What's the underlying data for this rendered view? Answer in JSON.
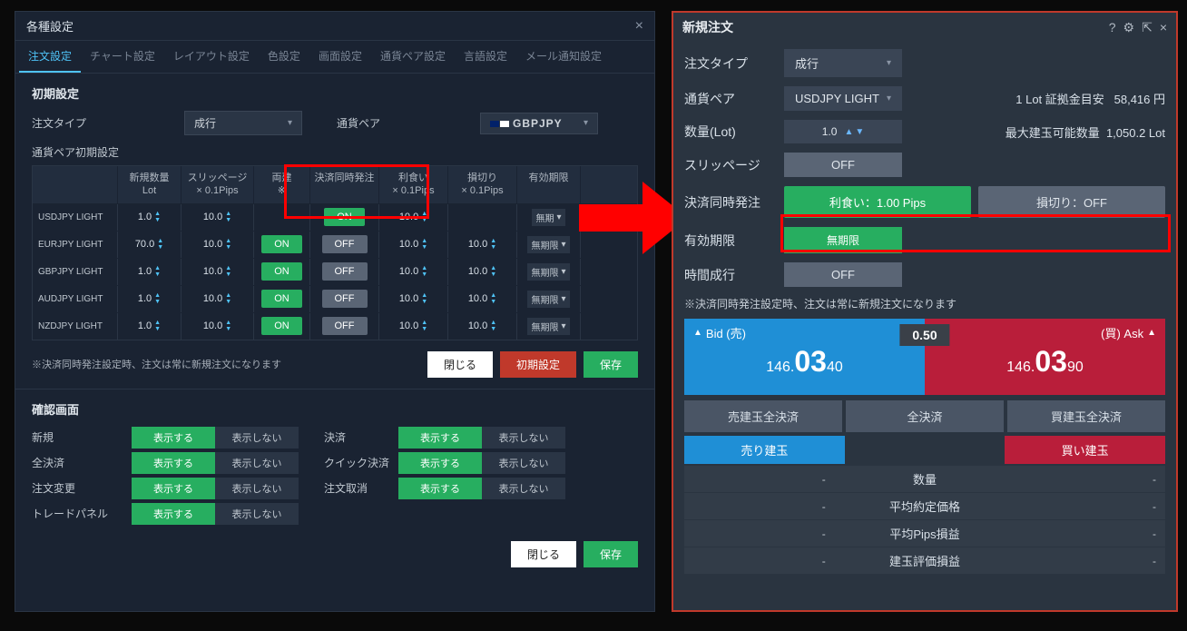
{
  "left": {
    "title": "各種設定",
    "tabs": [
      "注文設定",
      "チャート設定",
      "レイアウト設定",
      "色設定",
      "画面設定",
      "通貨ペア設定",
      "言語設定",
      "メール通知設定"
    ],
    "active_tab": 0,
    "section1_title": "初期設定",
    "order_type_label": "注文タイプ",
    "order_type_value": "成行",
    "pair_label": "通貨ペア",
    "pair_value": "GBPJPY",
    "pair_init_label": "通貨ペア初期設定",
    "headers": [
      "",
      "新規数量\nLot",
      "スリッページ\n× 0.1Pips",
      "両建\n※",
      "決済同時発注",
      "利食い\n× 0.1Pips",
      "損切り\n× 0.1Pips",
      "有効期限"
    ],
    "rows": [
      {
        "pair": "USDJPY LIGHT",
        "lot": "1.0",
        "slip": "10.0",
        "both": "",
        "settle": "ON",
        "tp": "10.0",
        "sl": "",
        "exp": "無期"
      },
      {
        "pair": "EURJPY LIGHT",
        "lot": "70.0",
        "slip": "10.0",
        "both": "ON",
        "settle": "OFF",
        "tp": "10.0",
        "sl": "10.0",
        "exp": "無期限"
      },
      {
        "pair": "GBPJPY LIGHT",
        "lot": "1.0",
        "slip": "10.0",
        "both": "ON",
        "settle": "OFF",
        "tp": "10.0",
        "sl": "10.0",
        "exp": "無期限"
      },
      {
        "pair": "AUDJPY LIGHT",
        "lot": "1.0",
        "slip": "10.0",
        "both": "ON",
        "settle": "OFF",
        "tp": "10.0",
        "sl": "10.0",
        "exp": "無期限"
      },
      {
        "pair": "NZDJPY LIGHT",
        "lot": "1.0",
        "slip": "10.0",
        "both": "ON",
        "settle": "OFF",
        "tp": "10.0",
        "sl": "10.0",
        "exp": "無期限"
      }
    ],
    "note": "※決済同時発注設定時、注文は常に新規注文になります",
    "btn_close": "閉じる",
    "btn_reset": "初期設定",
    "btn_save": "保存",
    "section2_title": "確認画面",
    "confirm": [
      {
        "l": "新規",
        "r": "決済"
      },
      {
        "l": "全決済",
        "r": "クイック決済"
      },
      {
        "l": "注文変更",
        "r": "注文取消"
      },
      {
        "l": "トレードパネル",
        "r": ""
      }
    ],
    "show_label": "表示する",
    "hide_label": "表示しない"
  },
  "right": {
    "title": "新規注文",
    "order_type_label": "注文タイプ",
    "order_type_value": "成行",
    "pair_label": "通貨ペア",
    "pair_value": "USDJPY LIGHT",
    "margin_label": "1 Lot 証拠金目安",
    "margin_value": "58,416 円",
    "qty_label": "数量(Lot)",
    "qty_value": "1.0",
    "maxpos_label": "最大建玉可能数量",
    "maxpos_value": "1,050.2 Lot",
    "slip_label": "スリッページ",
    "slip_value": "OFF",
    "simul_label": "決済同時発注",
    "tp_text": "利食い：1.00 Pips",
    "sl_text": "損切り：OFF",
    "exp_label": "有効期限",
    "exp_value": "無期限",
    "time_label": "時間成行",
    "time_value": "OFF",
    "note": "※決済同時発注設定時、注文は常に新規注文になります",
    "bid_label": "Bid (売)",
    "ask_label": "(買) Ask",
    "spread": "0.50",
    "bid_price": {
      "whole": "146.",
      "big": "03",
      "dec": "40"
    },
    "ask_price": {
      "whole": "146.",
      "big": "03",
      "dec": "90"
    },
    "settle_sell": "売建玉全決済",
    "settle_all": "全決済",
    "settle_buy": "買建玉全決済",
    "pos_sell": "売り建玉",
    "pos_buy": "買い建玉",
    "info_rows": [
      {
        "l": "-",
        "m": "数量",
        "r": "-"
      },
      {
        "l": "-",
        "m": "平均約定価格",
        "r": "-"
      },
      {
        "l": "-",
        "m": "平均Pips損益",
        "r": "-"
      },
      {
        "l": "-",
        "m": "建玉評価損益",
        "r": "-"
      }
    ]
  }
}
